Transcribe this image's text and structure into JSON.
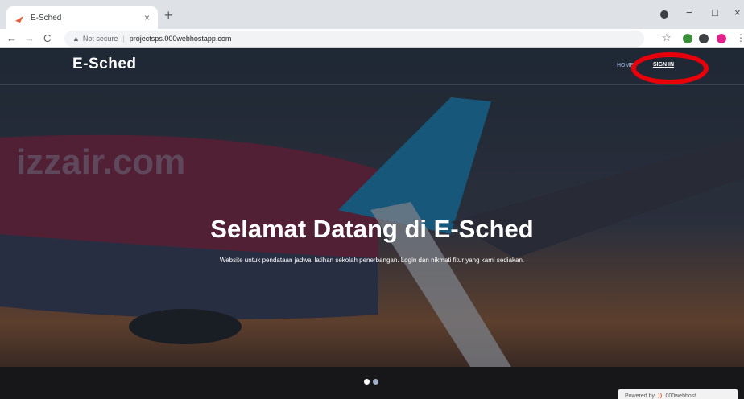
{
  "browser": {
    "tab_title": "E-Sched",
    "tab_close": "×",
    "new_tab": "+",
    "address_warning": "Not secure",
    "url": "projectsps.000webhostapp.com",
    "back": "←",
    "forward": "→",
    "reload": "C",
    "minimize": "−",
    "maximize": "□",
    "close": "×",
    "star": "☆",
    "kebab": "⋮"
  },
  "page": {
    "brand": "E-Sched",
    "nav": {
      "home": "HOME",
      "signin": "SIGN IN"
    },
    "hero": {
      "title": "Selamat Datang di E-Sched",
      "subtitle": "Website untuk pendataan jadwal latihan sekolah penerbangan. Login dan nikmati fitur yang kami sediakan."
    },
    "background_text": "izzair.com",
    "powered_by": {
      "label": "Powered by",
      "brand": "000webhost"
    }
  },
  "colors": {
    "highlight_circle": "#e8000b",
    "brand_text": "#ffffff"
  }
}
